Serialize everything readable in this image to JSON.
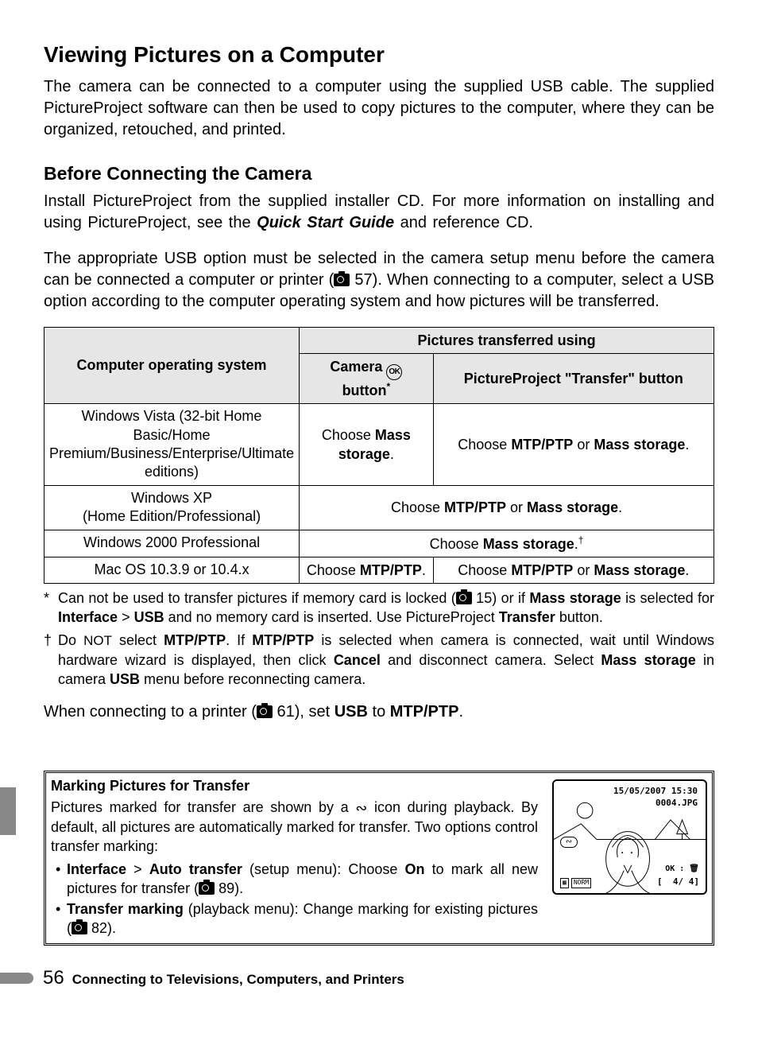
{
  "heading_main": "Viewing Pictures on a Computer",
  "intro": "The camera can be connected to a computer using the supplied USB cable. The supplied PictureProject software can then be used to copy pictures to the computer, where they can be organized, retouched, and printed.",
  "heading_sub": "Before Connecting the Camera",
  "para_before_a": "Install PictureProject from the supplied installer CD.  For more information on installing and using PictureProject, see the ",
  "para_before_emph": "Quick Start Guide",
  "para_before_b": " and reference CD.",
  "para_usb": "The appropriate USB option must be selected in the camera setup menu before the camera can be connected a computer or printer (",
  "para_usb_ref": " 57).  When connecting to a computer, select a USB option according to the computer operating system and how pictures will be transferred.",
  "table": {
    "head_os": "Computer operating system",
    "head_span": "Pictures transferred using",
    "head_cam": "Camera ",
    "head_cam_suffix": " button",
    "head_star": "*",
    "head_pp": "PictureProject \"Transfer\" button",
    "rows": [
      {
        "os": "Windows Vista (32-bit Home Basic/Home Premium/Business/Enterprise/Ultimate editions)",
        "col1_a": "Choose ",
        "col1_b": "Mass storage",
        "col1_c": ".",
        "col2_a": "Choose ",
        "col2_b": "MTP/PTP",
        "col2_c": " or ",
        "col2_d": "Mass storage",
        "col2_e": "."
      },
      {
        "os": "Windows XP\n(Home Edition/Professional)",
        "merged_a": "Choose ",
        "merged_b": "MTP/PTP",
        "merged_c": " or ",
        "merged_d": "Mass storage",
        "merged_e": "."
      },
      {
        "os": "Windows 2000 Professional",
        "merged_a": "Choose ",
        "merged_b": "Mass storage",
        "merged_c": ".",
        "dagger": "†"
      },
      {
        "os": "Mac OS 10.3.9 or 10.4.x",
        "col1_a": "Choose ",
        "col1_b": "MTP/PTP",
        "col1_c": ".",
        "col2_a": "Choose ",
        "col2_b": "MTP/PTP",
        "col2_c": " or ",
        "col2_d": "Mass storage",
        "col2_e": "."
      }
    ]
  },
  "fn_star_a": "Can not be used to transfer pictures if memory card is locked (",
  "fn_star_ref": " 15) or if ",
  "fn_star_b": "Mass storage",
  "fn_star_c": " is selected for ",
  "fn_star_d": "Interface",
  "fn_star_gt": ">",
  "fn_star_e": "USB",
  "fn_star_f": " and no memory card is inserted.  Use PictureProject ",
  "fn_star_g": "Transfer",
  "fn_star_h": " button.",
  "fn_dag_a": "Do ",
  "fn_dag_not": "not",
  "fn_dag_b": " select ",
  "fn_dag_c": "MTP/PTP",
  "fn_dag_d": ".  If ",
  "fn_dag_e": "MTP/PTP",
  "fn_dag_f": " is selected when camera is connected, wait until Windows hardware wizard is displayed, then click ",
  "fn_dag_g": "Cancel",
  "fn_dag_h": " and disconnect camera.  Select ",
  "fn_dag_i": "Mass storage",
  "fn_dag_j": " in camera ",
  "fn_dag_k": "USB",
  "fn_dag_l": " menu before reconnecting camera.",
  "printer_a": "When connecting to a printer (",
  "printer_ref": " 61), set ",
  "printer_b": "USB",
  "printer_c": " to ",
  "printer_d": "MTP/PTP",
  "printer_e": ".",
  "infobox": {
    "title": "Marking Pictures for Transfer",
    "text_a": "Pictures marked for transfer are shown by a ",
    "text_b": " icon during playback.  By default, all pictures are automatically marked for transfer.  Two options control transfer marking:",
    "bullet1_a": "Interface",
    "bullet1_gt": ">",
    "bullet1_b": "Auto transfer",
    "bullet1_c": " (setup menu): Choose ",
    "bullet1_d": "On",
    "bullet1_e": " to mark all new pictures for transfer (",
    "bullet1_ref": " 89).",
    "bullet2_a": "Transfer marking",
    "bullet2_b": " (playback menu): Change marking for existing pictures (",
    "bullet2_ref": " 82)."
  },
  "lcd": {
    "date": "15/05/2007 15:30",
    "file": "0004.JPG",
    "ok": "OK : ",
    "norm": "NORM",
    "count": "4/   4]"
  },
  "page_number": "56",
  "footer_title": "Connecting to Televisions, Computers, and Printers"
}
